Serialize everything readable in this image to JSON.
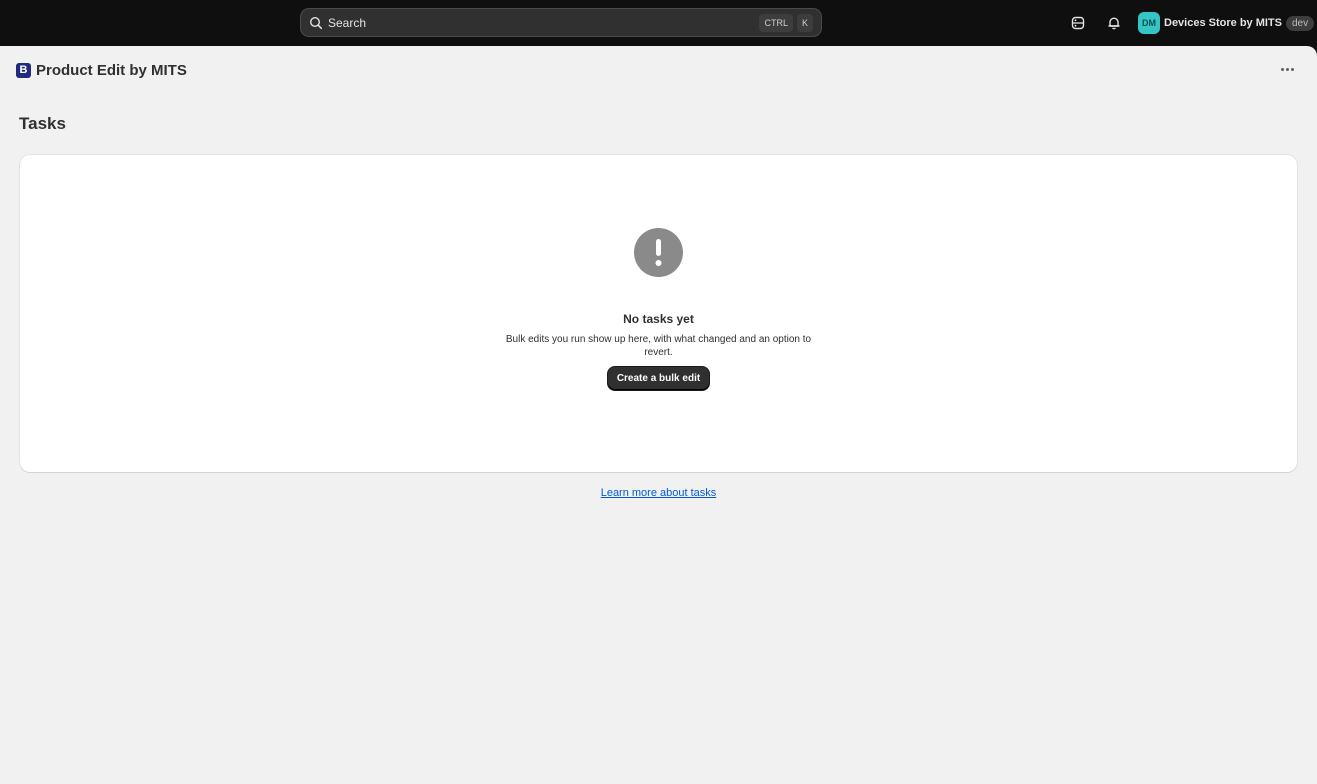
{
  "topbar": {
    "search": {
      "placeholder": "Search",
      "shortcut_mod": "CTRL",
      "shortcut_key": "K"
    },
    "icons": [
      "database-icon",
      "bell-icon"
    ],
    "store": {
      "initials": "DM",
      "name": "Devices Store by MITS",
      "badge": "dev",
      "avatar_color": "#36c5c5"
    }
  },
  "app": {
    "logo_letter": "B",
    "title": "Product Edit by MITS"
  },
  "page": {
    "title": "Tasks"
  },
  "empty_state": {
    "icon": "alert-circle-icon",
    "title": "No tasks yet",
    "description": "Bulk edits you run show up here, with what changed and an option to revert.",
    "button_label": "Create a bulk edit"
  },
  "footer": {
    "link_text": "Learn more about tasks",
    "link_color": "#005bd3"
  }
}
